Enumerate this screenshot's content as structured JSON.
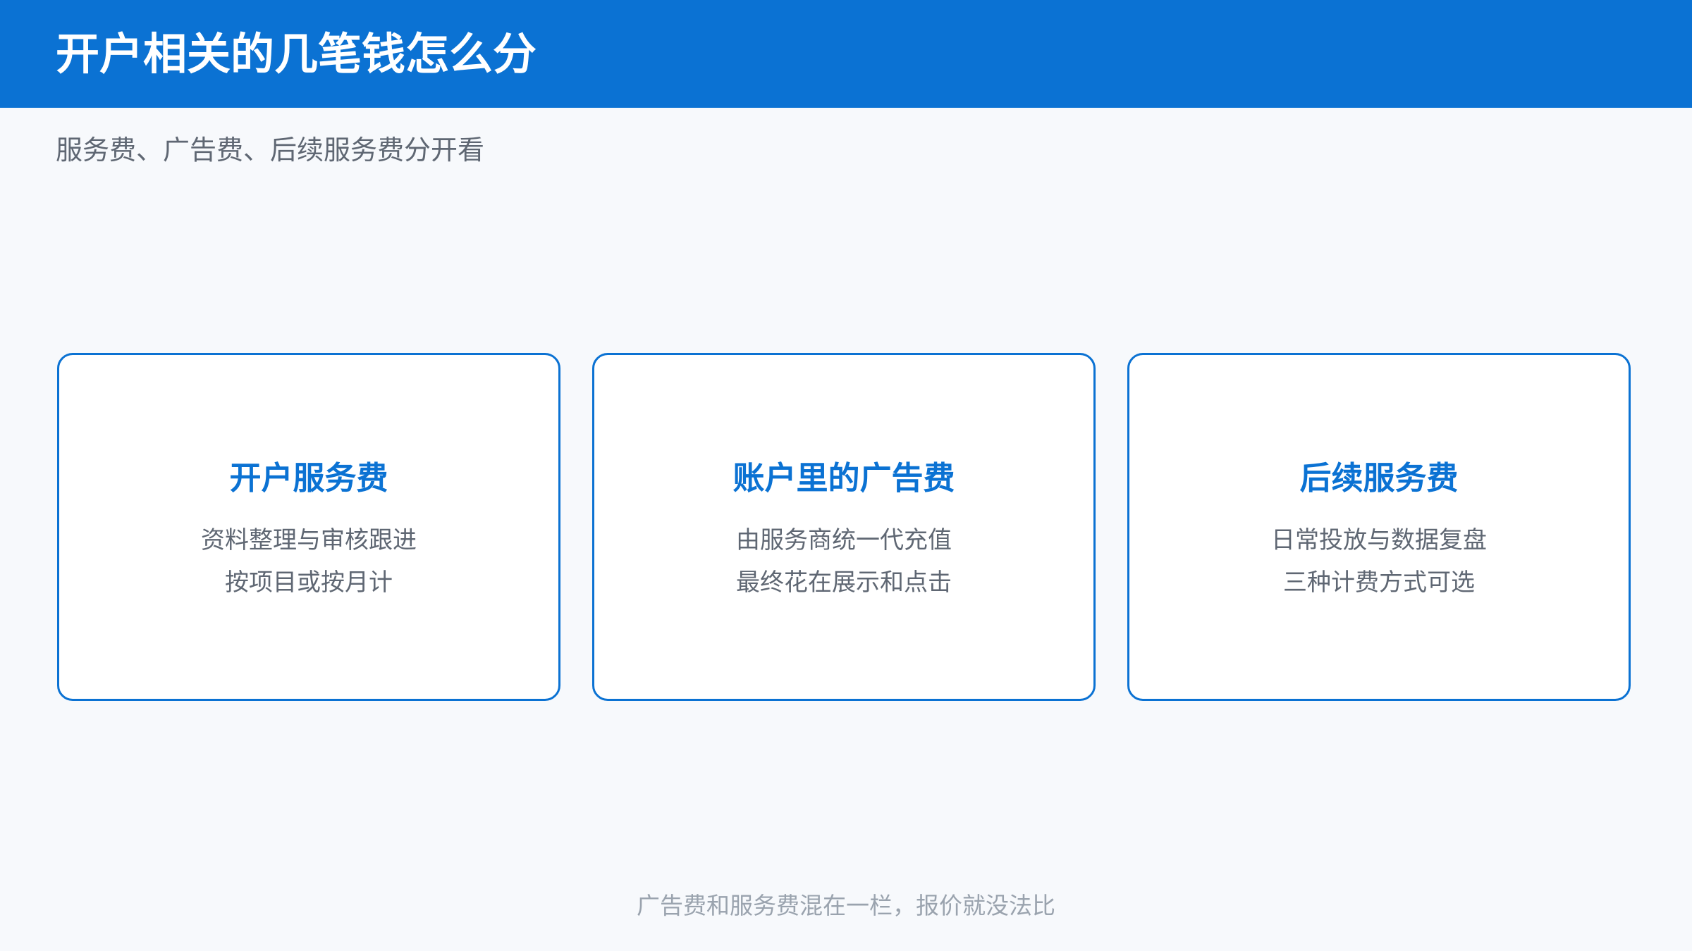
{
  "header": {
    "title": "开户相关的几笔钱怎么分"
  },
  "subtitle": "服务费、广告费、后续服务费分开看",
  "cards": [
    {
      "title": "开户服务费",
      "lines": [
        "资料整理与审核跟进",
        "按项目或按月计"
      ]
    },
    {
      "title": "账户里的广告费",
      "lines": [
        "由服务商统一代充值",
        "最终花在展示和点击"
      ]
    },
    {
      "title": "后续服务费",
      "lines": [
        "日常投放与数据复盘",
        "三种计费方式可选"
      ]
    }
  ],
  "footer_note": "广告费和服务费混在一栏，报价就没法比",
  "colors": {
    "brand_blue": "#0b72d3",
    "background": "#f7f9fc",
    "text_gray": "#5f6773",
    "footer_gray": "#9aa3ae"
  }
}
